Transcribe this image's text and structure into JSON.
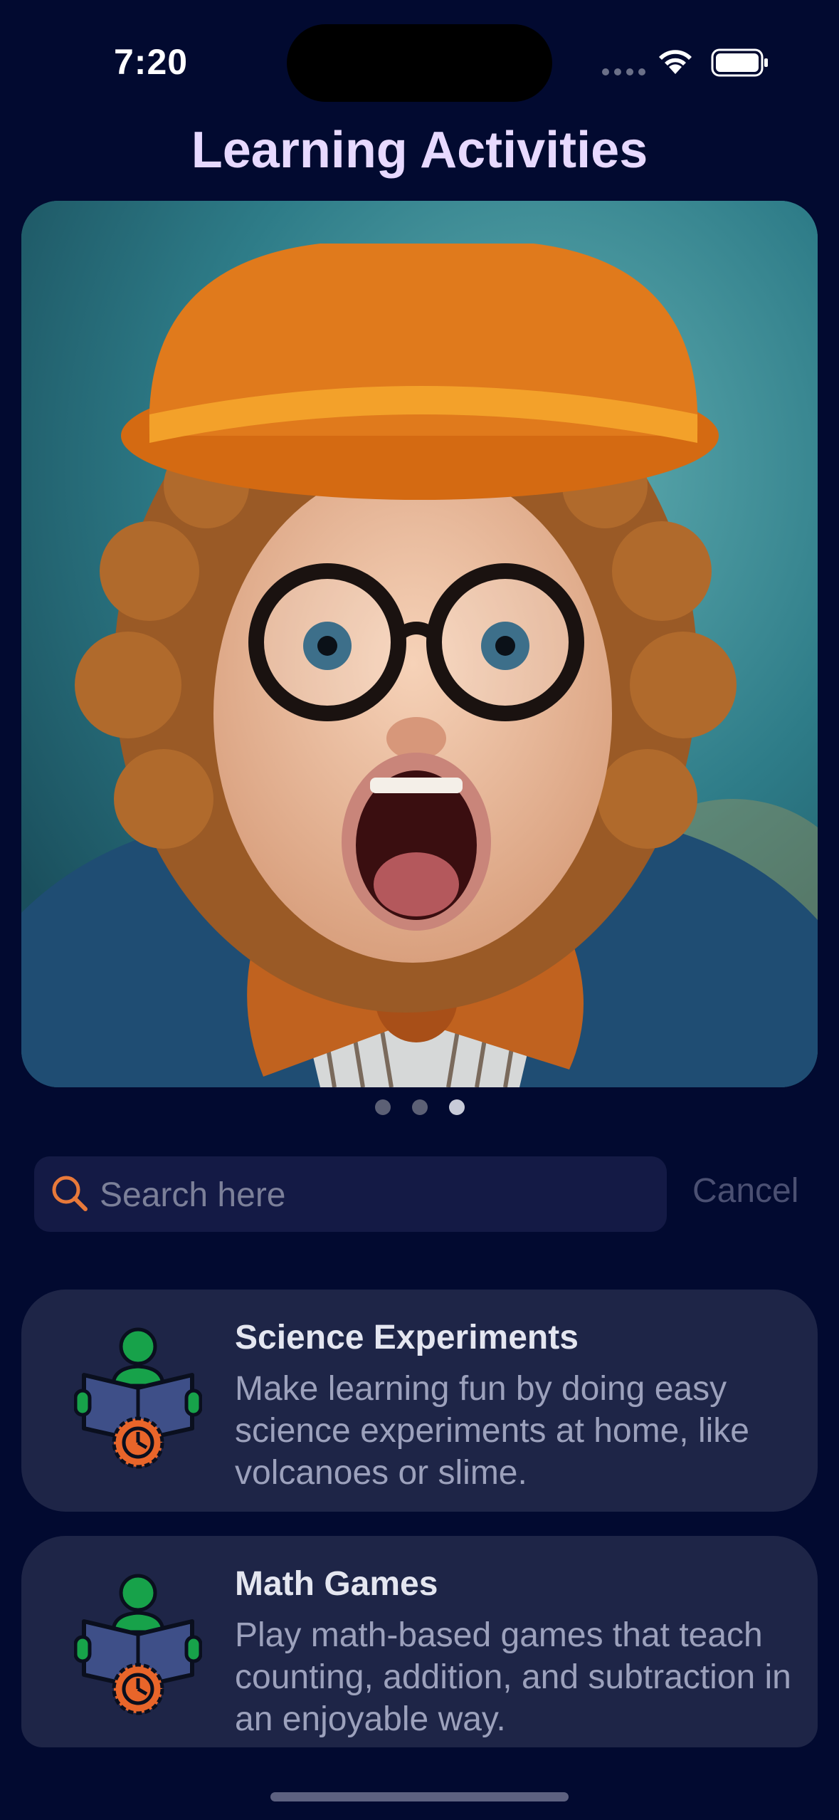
{
  "status_bar": {
    "time": "7:20"
  },
  "header": {
    "title": "Learning Activities"
  },
  "carousel": {
    "image_label": "Excited child with curly hair, glasses, orange hat and bow tie",
    "page_count": 3,
    "active_page": 3
  },
  "search": {
    "placeholder": "Search here",
    "value": "",
    "cancel_label": "Cancel"
  },
  "activities": [
    {
      "title": "Science Experiments",
      "description": "Make learning fun by doing easy science experiments at home, like volcanoes or slime.",
      "icon": "reading-student-icon"
    },
    {
      "title": "Math Games",
      "description": "Play math-based games that teach counting, addition, and subtraction in an enjoyable way.",
      "icon": "reading-student-icon"
    }
  ],
  "colors": {
    "background": "#020a30",
    "title": "#e7d9ff",
    "card": "#1e2547",
    "search_field": "#141a45",
    "accent_orange": "#e8793a"
  }
}
